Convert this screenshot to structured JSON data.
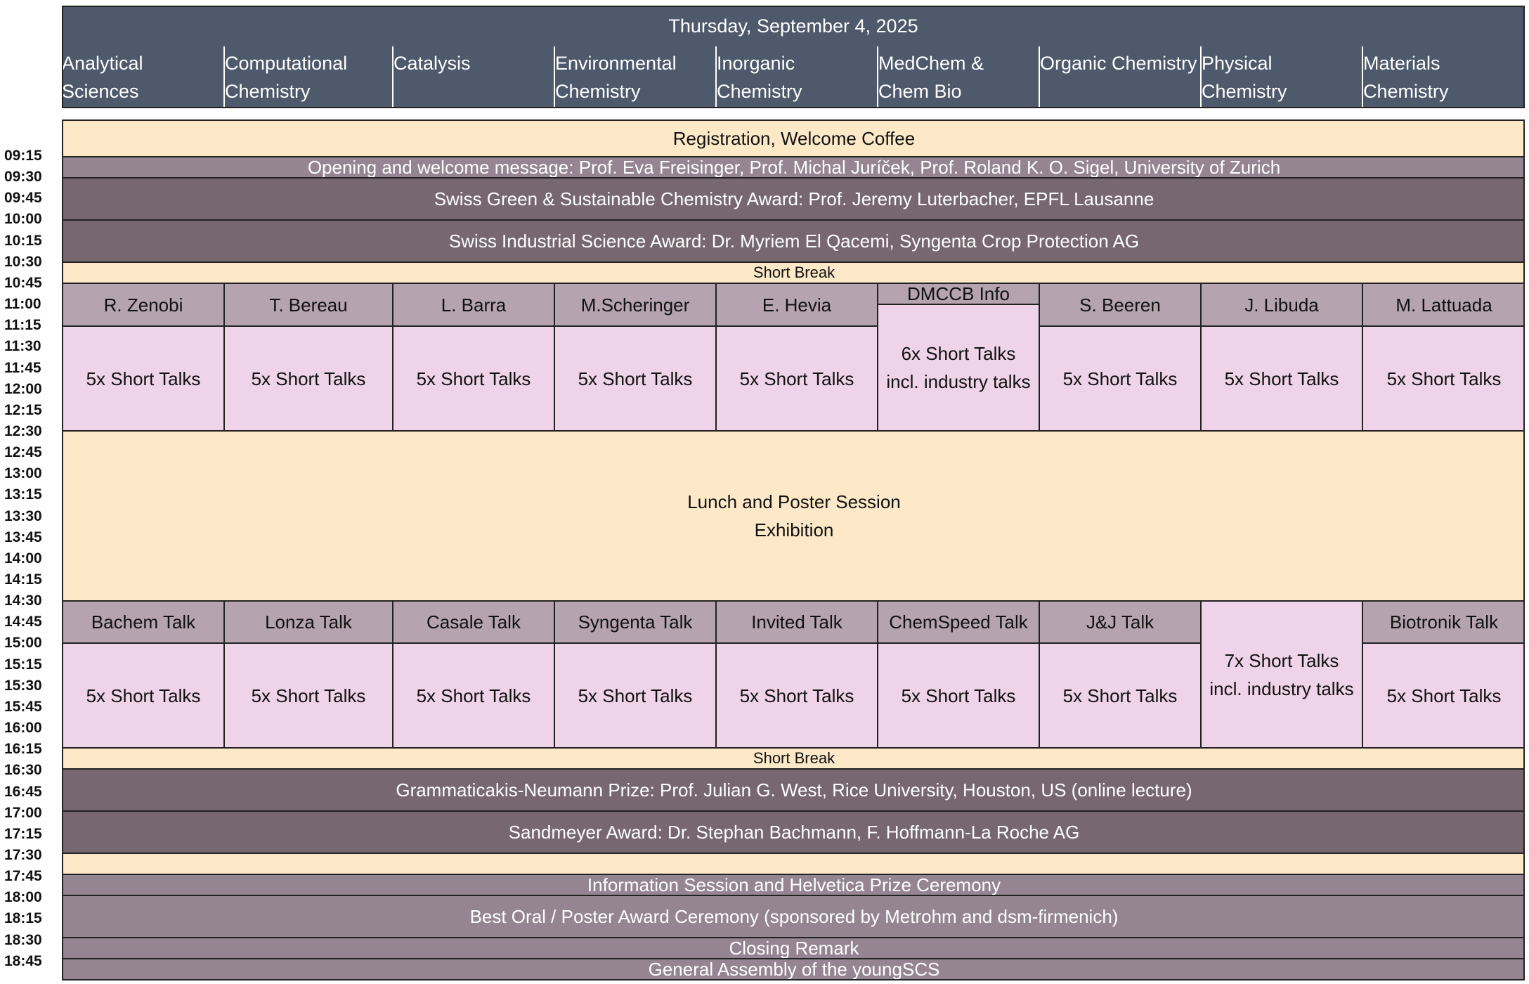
{
  "header": {
    "date": "Thursday, September 4, 2025",
    "sections": [
      [
        "Analytical",
        "Sciences"
      ],
      [
        "Computational",
        "Chemistry"
      ],
      [
        "Catalysis",
        ""
      ],
      [
        "Environmental",
        "Chemistry"
      ],
      [
        "Inorganic",
        "Chemistry"
      ],
      [
        "MedChem &",
        "Chem Bio"
      ],
      [
        "Organic Chemistry",
        ""
      ],
      [
        "Physical",
        "Chemistry"
      ],
      [
        "Materials",
        "Chemistry"
      ]
    ]
  },
  "times": [
    "09:15",
    "09:30",
    "09:45",
    "10:00",
    "10:15",
    "10:30",
    "10:45",
    "11:00",
    "11:15",
    "11:30",
    "11:45",
    "12:00",
    "12:15",
    "12:30",
    "12:45",
    "13:00",
    "13:15",
    "13:30",
    "13:45",
    "14:00",
    "14:15",
    "14:30",
    "14:45",
    "15:00",
    "15:15",
    "15:30",
    "15:45",
    "16:00",
    "16:15",
    "16:30",
    "16:45",
    "17:00",
    "17:15",
    "17:30",
    "17:45",
    "18:00",
    "18:15",
    "18:30",
    "18:45"
  ],
  "plenary": {
    "registration": "Registration, Welcome Coffee",
    "opening": "Opening and welcome message: Prof. Eva Freisinger, Prof. Michal Juríček, Prof. Roland K. O. Sigel, University of Zurich",
    "green_award": "Swiss Green & Sustainable Chemistry Award: Prof. Jeremy Luterbacher, EPFL Lausanne",
    "industrial_award": "Swiss Industrial Science Award: Dr. Myriem El Qacemi, Syngenta Crop Protection AG",
    "short_break_1": "Short Break",
    "lunch_line1": "Lunch and Poster Session",
    "lunch_line2": "Exhibition",
    "short_break_2": "Short Break",
    "grammaticakis": "Grammaticakis-Neumann Prize: Prof. Julian G. West, Rice University, Houston, US (online lecture)",
    "sandmeyer": "Sandmeyer Award: Dr. Stephan Bachmann, F. Hoffmann-La Roche AG",
    "info_session": "Information Session and Helvetica Prize Ceremony",
    "best_award": "Best Oral / Poster Award Ceremony (sponsored by Metrohm and dsm-firmenich)",
    "closing": "Closing Remark",
    "assembly": "General Assembly of the youngSCS"
  },
  "morning": {
    "chairs": [
      "R. Zenobi",
      "T. Bereau",
      "L. Barra",
      "M.Scheringer",
      "E. Hevia",
      "DMCCB Info",
      "S. Beeren",
      "J. Libuda",
      "M. Lattuada"
    ],
    "talks": "5x Short Talks",
    "medchem_line1": "6x Short Talks",
    "medchem_line2": "incl. industry talks"
  },
  "afternoon": {
    "chairs": [
      "Bachem Talk",
      "Lonza Talk",
      "Casale Talk",
      "Syngenta Talk",
      "Invited Talk",
      "ChemSpeed Talk",
      "J&J  Talk",
      "",
      "Biotronik Talk"
    ],
    "talks": "5x Short Talks",
    "physical_line1": "7x Short Talks",
    "physical_line2": "incl. industry talks"
  }
}
